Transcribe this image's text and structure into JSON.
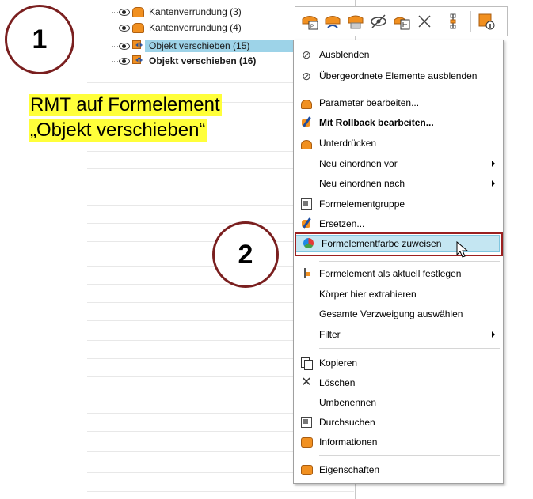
{
  "tree": {
    "rows": [
      {
        "label": "Kantenverrundung (3)"
      },
      {
        "label": "Kantenverrundung (4)"
      },
      {
        "label": "Objekt verschieben (15)"
      },
      {
        "label": "Objekt verschieben (16)"
      }
    ]
  },
  "callouts": {
    "step1": "1",
    "step2": "2"
  },
  "annotation": {
    "line1": "RMT auf Formelement",
    "line2": "„Objekt verschieben“"
  },
  "toolbar": {
    "buttons": [
      "parameter-edit-icon",
      "rollback-edit-icon",
      "suppress-icon",
      "hide-icon",
      "select-branch-icon",
      "delete-icon",
      "set-current-icon",
      "info-icon"
    ]
  },
  "context_menu": {
    "items": [
      {
        "label": "Ausblenden",
        "icon": "hide-icon"
      },
      {
        "label": "Übergeordnete Elemente ausblenden",
        "icon": "hide-parents-icon"
      },
      {
        "label": "Parameter bearbeiten...",
        "icon": "parameter-edit-icon"
      },
      {
        "label": "Mit Rollback bearbeiten...",
        "icon": "rollback-edit-icon"
      },
      {
        "label": "Unterdrücken",
        "icon": "suppress-icon"
      },
      {
        "label": "Neu einordnen vor",
        "icon": ""
      },
      {
        "label": "Neu einordnen nach",
        "icon": ""
      },
      {
        "label": "Formelementgruppe",
        "icon": "feature-group-icon"
      },
      {
        "label": "Ersetzen...",
        "icon": "replace-icon"
      },
      {
        "label": "Formelementfarbe zuweisen",
        "icon": "colour-icon"
      },
      {
        "label": "Formelement als aktuell festlegen",
        "icon": "set-current-icon"
      },
      {
        "label": "Körper hier extrahieren",
        "icon": ""
      },
      {
        "label": "Gesamte Verzweigung auswählen",
        "icon": ""
      },
      {
        "label": "Filter",
        "icon": ""
      },
      {
        "label": "Kopieren",
        "icon": "copy-icon"
      },
      {
        "label": "Löschen",
        "icon": "delete-icon"
      },
      {
        "label": "Umbenennen",
        "icon": ""
      },
      {
        "label": "Durchsuchen",
        "icon": "browse-icon"
      },
      {
        "label": "Informationen",
        "icon": "info-icon"
      },
      {
        "label": "Eigenschaften",
        "icon": "properties-icon"
      }
    ]
  },
  "colors": {
    "selection": "#9dd3e8",
    "highlight_frame": "#9b2020",
    "annotation_bg": "#ffff3a",
    "feature_orange": "#f19020"
  }
}
